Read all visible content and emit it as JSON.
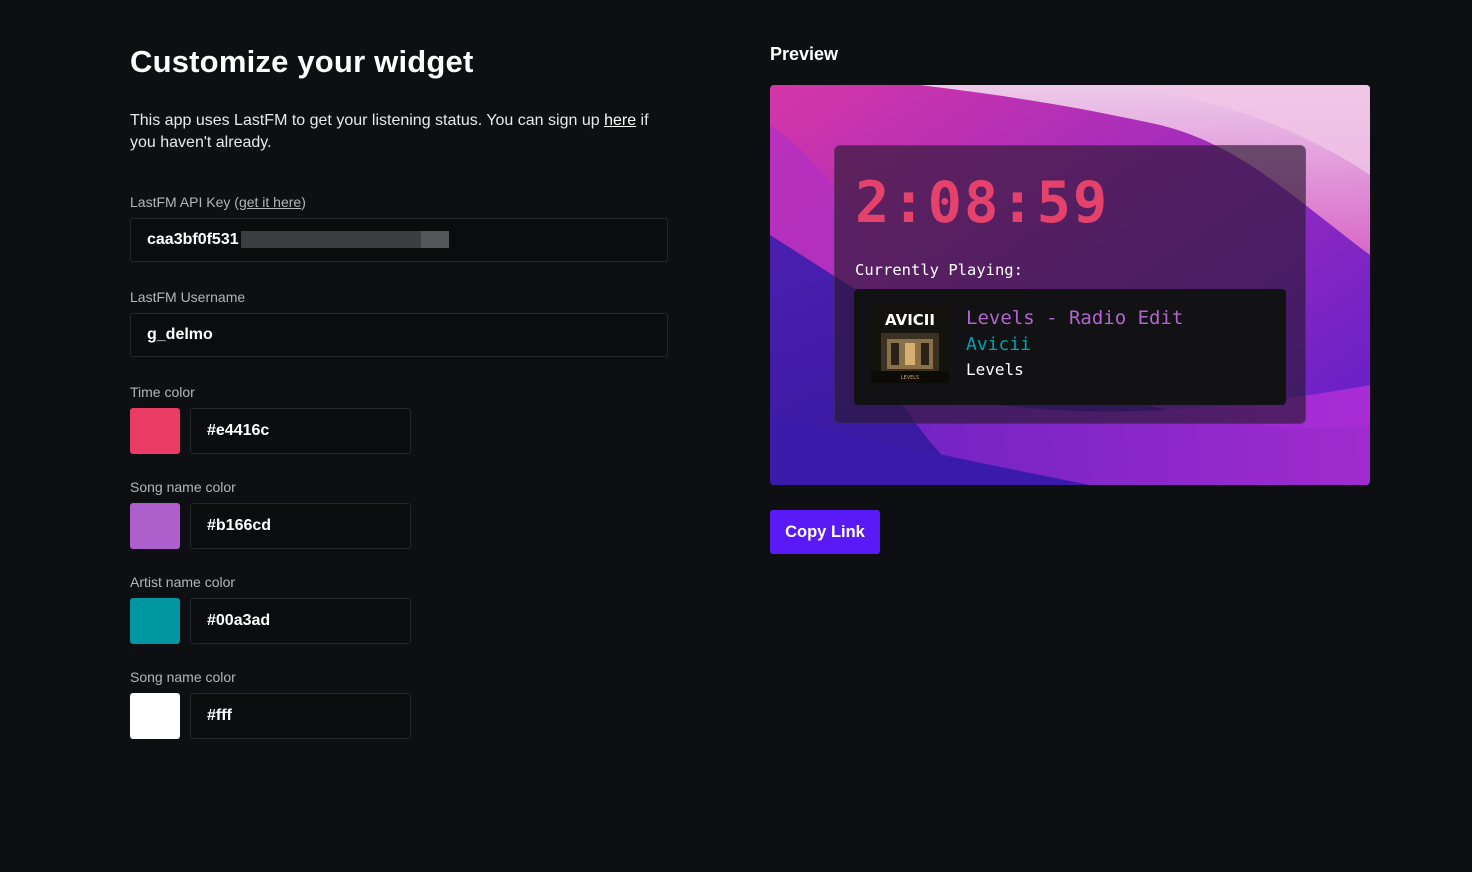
{
  "form": {
    "title": "Customize your widget",
    "intro_text": "This app uses LastFM to get your listening status. You can sign up ",
    "intro_link": "here",
    "intro_text_after": " if you haven't already.",
    "api_key": {
      "label_prefix": "LastFM API Key (",
      "label_link": "get it here",
      "label_suffix": ")",
      "value": "caa3bf0f531"
    },
    "username": {
      "label": "LastFM Username",
      "value": "g_delmo"
    },
    "colors": [
      {
        "label": "Time color",
        "value": "#e4416c",
        "swatch": "#e93b64"
      },
      {
        "label": "Song name color",
        "value": "#b166cd",
        "swatch": "#ad5fcb"
      },
      {
        "label": "Artist name color",
        "value": "#00a3ad",
        "swatch": "#0097a0"
      },
      {
        "label": "Song name color",
        "value": "#fff",
        "swatch": "#ffffff"
      }
    ]
  },
  "preview": {
    "title": "Preview",
    "time": "2:08:59",
    "currently_playing_label": "Currently Playing:",
    "track": {
      "song": "Levels - Radio Edit",
      "artist": "Avicii",
      "album": "Levels",
      "cover_brand": "AVICII",
      "cover_caption": "LEVELS"
    },
    "copy_button": "Copy Link"
  }
}
